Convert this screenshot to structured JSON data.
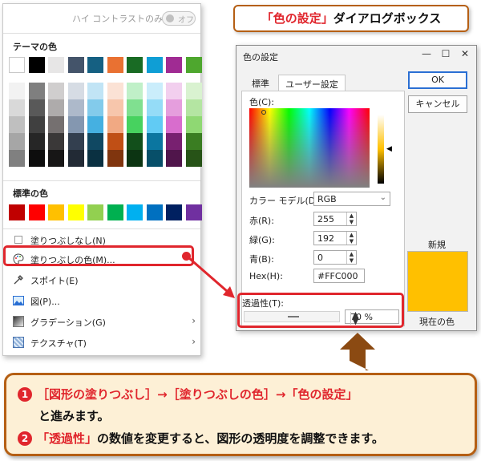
{
  "menu": {
    "high_contrast_label": "ハイ コントラストのみ",
    "toggle_label": "オフ",
    "theme_colors_title": "テーマの色",
    "standard_colors_title": "標準の色",
    "items": {
      "no_fill": "塗りつぶしなし(N)",
      "fill_color": "塗りつぶしの色(M)...",
      "eyedropper": "スポイト(E)",
      "picture": "図(P)...",
      "gradient": "グラデーション(G)",
      "texture": "テクスチャ(T)"
    },
    "theme_top_row": [
      "#ffffff",
      "#000000",
      "#e7e6e6",
      "#44546a",
      "#156082",
      "#e97132",
      "#196b24",
      "#0f9ed5",
      "#a02b93",
      "#4ea72e"
    ],
    "theme_shades": [
      [
        "#f2f2f2",
        "#7f7f7f",
        "#d0cece",
        "#d6dce4",
        "#c1e4f5",
        "#fbe2d5",
        "#c0f0c8",
        "#caedfb",
        "#f2cfee",
        "#d9f2d0"
      ],
      [
        "#d9d9d9",
        "#595959",
        "#aeabab",
        "#adb9ca",
        "#83cbeb",
        "#f7c6ac",
        "#80e090",
        "#95dcf7",
        "#e59edd",
        "#b4e5a2"
      ],
      [
        "#bfbfbf",
        "#404040",
        "#757070",
        "#8497b0",
        "#45b0e1",
        "#f1a983",
        "#47d25f",
        "#61cbf4",
        "#d86dcd",
        "#8fd873"
      ],
      [
        "#a6a6a6",
        "#262626",
        "#3a3838",
        "#333f4f",
        "#104862",
        "#c04f15",
        "#124f1b",
        "#0b76a0",
        "#782070",
        "#3a7d22"
      ],
      [
        "#808080",
        "#0d0d0d",
        "#171616",
        "#222a35",
        "#0a3041",
        "#80350e",
        "#0c3412",
        "#074f69",
        "#50154b",
        "#275317"
      ]
    ],
    "standard_row": [
      "#c00000",
      "#ff0000",
      "#ffc000",
      "#ffff00",
      "#92d050",
      "#00b050",
      "#00b0f0",
      "#0070c0",
      "#002060",
      "#7030a0"
    ]
  },
  "banner": {
    "part1": "「色の設定」",
    "part2": "ダイアログボックス"
  },
  "dialog": {
    "title": "色の設定",
    "tabs": {
      "standard": "標準",
      "custom": "ユーザー設定"
    },
    "color_label": "色(C):",
    "model_label": "カラー モデル(D):",
    "model_value": "RGB",
    "red_label": "赤(R):",
    "red_value": "255",
    "green_label": "緑(G):",
    "green_value": "192",
    "blue_label": "青(B):",
    "blue_value": "0",
    "hex_label": "Hex(H):",
    "hex_value": "#FFC000",
    "transparency_label": "透過性(T):",
    "transparency_value": "70 %",
    "ok": "OK",
    "cancel": "キャンセル",
    "new_label": "新規",
    "current_label": "現在の色",
    "preview_color": "#ffc000",
    "transparency_percent": 70
  },
  "instructions": {
    "n1": "1",
    "n2": "2",
    "l1_a": "［図形の塗りつぶし］→［塗りつぶしの色］→「色の設定」",
    "l1_b": "と進みます。",
    "l2_a": "「透過性」",
    "l2_b": "の数値を変更すると、図形の透明度を調整できます。"
  }
}
